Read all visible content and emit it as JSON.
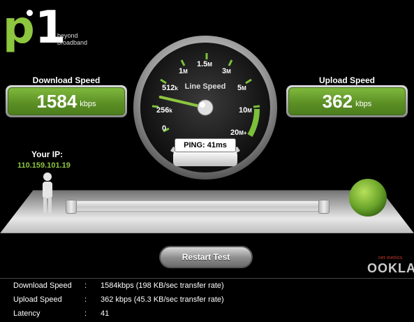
{
  "logo": {
    "brand_p": "p",
    "brand_1": "1",
    "tag_line1": "beyond",
    "tag_line2": "broadband"
  },
  "download": {
    "label": "Download Speed",
    "value": "1584",
    "unit": "kbps"
  },
  "upload": {
    "label": "Upload Speed",
    "value": "362",
    "unit": "kbps"
  },
  "gauge": {
    "title": "Line Speed",
    "ping": "PING: 41ms",
    "needle_fraction": 0.18,
    "ticks": {
      "t0": "0",
      "t256": "256",
      "t256u": "k",
      "t512": "512",
      "t512u": "k",
      "t1m": "1",
      "t1mu": "M",
      "t15m": "1.5",
      "t15mu": "M",
      "t3m": "3",
      "t3mu": "M",
      "t5m": "5",
      "t5mu": "M",
      "t10m": "10",
      "t10mu": "M",
      "t20m": "20",
      "t20mu": "M+"
    }
  },
  "ip": {
    "label": "Your IP:",
    "value": "110.159.101.19"
  },
  "restart_label": "Restart Test",
  "ookla": {
    "netmetrics": "net metrics",
    "name": "OOKLA"
  },
  "results": [
    {
      "key": "Download Speed",
      "sep": ":",
      "value": "1584kbps (198 KB/sec transfer rate)"
    },
    {
      "key": "Upload Speed",
      "sep": ":",
      "value": "362 kbps (45.3 KB/sec transfer rate)"
    },
    {
      "key": "Latency",
      "sep": ":",
      "value": "41"
    }
  ],
  "colors": {
    "accent": "#8dc63f",
    "panel_green": "#5d9126",
    "background": "#000000"
  }
}
